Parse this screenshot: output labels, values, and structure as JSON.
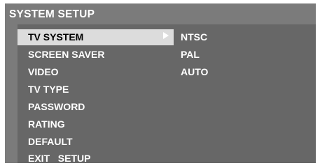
{
  "title": "SYSTEM SETUP",
  "menu": {
    "items": [
      {
        "label": "TV SYSTEM",
        "selected": true
      },
      {
        "label": "SCREEN SAVER",
        "selected": false
      },
      {
        "label": "VIDEO",
        "selected": false
      },
      {
        "label": "TV TYPE",
        "selected": false
      },
      {
        "label": "PASSWORD",
        "selected": false
      },
      {
        "label": "RATING",
        "selected": false
      },
      {
        "label": "DEFAULT",
        "selected": false
      },
      {
        "label": "EXIT   SETUP",
        "selected": false
      }
    ]
  },
  "submenu": {
    "indicator_icon": "triangle-right-icon",
    "options": [
      {
        "label": "NTSC"
      },
      {
        "label": "PAL"
      },
      {
        "label": "AUTO"
      }
    ]
  },
  "colors": {
    "frame": "#7b7b7b",
    "panel": "#676767",
    "highlight": "#dcdcdc",
    "text": "#ffffff",
    "highlight_text": "#000000"
  }
}
